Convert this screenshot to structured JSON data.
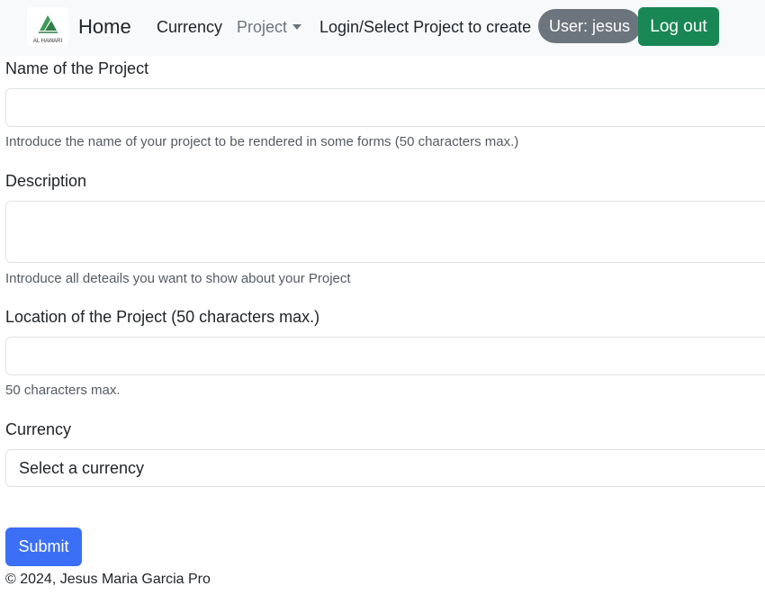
{
  "navbar": {
    "logo_icon": "company-logo",
    "logo_text": "AL HAWARI",
    "brand": "Home",
    "links": {
      "currency": "Currency",
      "project": "Project",
      "login_select": "Login/Select Project to create"
    },
    "user_badge": "User: jesus",
    "logout_label": "Log out",
    "colors": {
      "background": "#f8f9fa",
      "user_badge": "#6c757d",
      "logout": "#198754"
    }
  },
  "form": {
    "name": {
      "label": "Name of the Project",
      "value": "",
      "help": "Introduce the name of your project to be rendered in some forms (50 characters max.)"
    },
    "description": {
      "label": "Description",
      "value": "",
      "help": "Introduce all deteails you want to show about your Project"
    },
    "location": {
      "label": "Location of the Project (50 characters max.)",
      "value": "",
      "help": "50 characters max."
    },
    "currency": {
      "label": "Currency",
      "selected": "Select a currency"
    },
    "submit_label": "Submit",
    "submit_color": "#3b6ff5"
  },
  "footer": {
    "text": "© 2024, Jesus Maria Garcia Pro"
  }
}
